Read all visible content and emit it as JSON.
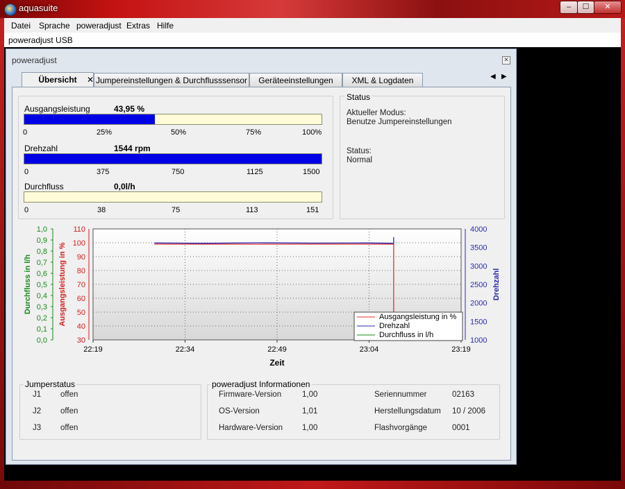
{
  "window": {
    "title": "aquasuite",
    "buttons": [
      "–",
      "☐",
      "✕"
    ]
  },
  "menu": [
    {
      "label": "Datei"
    },
    {
      "label": "Sprache"
    },
    {
      "label": "poweradjust"
    },
    {
      "label": "Extras"
    },
    {
      "label": "Hilfe"
    }
  ],
  "device_label": "poweradjust USB",
  "panel": {
    "title": "poweradjust",
    "tabs": [
      {
        "label": "Übersicht"
      },
      {
        "label": "Jumpereinstellungen & Durchflusssensor"
      },
      {
        "label": "Geräteeinstellungen"
      },
      {
        "label": "XML & Logdaten"
      }
    ],
    "tab_close": "✕",
    "tab_arrows": [
      "◀",
      "▶"
    ]
  },
  "gauges": [
    {
      "label": "Ausgangsleistung",
      "value_text": "43,95 %",
      "fraction": 0.4395,
      "ticks": [
        "0",
        "25%",
        "50%",
        "75%",
        "100%"
      ]
    },
    {
      "label": "Drehzahl",
      "value_text": "1544 rpm",
      "fraction": 1.0,
      "ticks": [
        "0",
        "375",
        "750",
        "1125",
        "1500"
      ]
    },
    {
      "label": "Durchfluss",
      "value_text": "0,0l/h",
      "fraction": 0.0,
      "ticks": [
        "0",
        "38",
        "75",
        "113",
        "151"
      ]
    }
  ],
  "status": {
    "title": "Status",
    "mode_label": "Aktueller Modus:",
    "mode_value": "Benutze Jumpereinstellungen",
    "status_label": "Status:",
    "status_value": "Normal"
  },
  "chart_data": {
    "type": "line",
    "xlabel": "Zeit",
    "x_ticks": [
      "22:19",
      "22:34",
      "22:49",
      "23:04",
      "23:19"
    ],
    "left_axis_flow": {
      "label": "Durchfluss in l/h",
      "ticks": [
        "1,0",
        "0,9",
        "0,8",
        "0,7",
        "0,6",
        "0,5",
        "0,4",
        "0,3",
        "0,2",
        "0,1",
        "0,0"
      ],
      "range": [
        0,
        1
      ],
      "color": "#1a8a1a"
    },
    "left_axis_power": {
      "label": "Ausgangsleistung in %",
      "ticks": [
        "110",
        "100",
        "90",
        "80",
        "70",
        "60",
        "50",
        "40",
        "30"
      ],
      "range": [
        30,
        110
      ],
      "color": "#d42020"
    },
    "right_axis_rpm": {
      "label": "Drehzahl",
      "ticks": [
        "4000",
        "3500",
        "3000",
        "2500",
        "2000",
        "1500",
        "1000"
      ],
      "range": [
        1000,
        4000
      ],
      "color": "#2a2ab0"
    },
    "series": [
      {
        "name": "Ausgangsleistung in %",
        "color": "#e03030",
        "axis": "power",
        "points": [
          [
            0.1667,
            99
          ],
          [
            0.8167,
            99
          ],
          [
            0.8167,
            44
          ]
        ]
      },
      {
        "name": "Drehzahl",
        "color": "#2a2ab0",
        "axis": "rpm",
        "points": [
          [
            0.1667,
            3620
          ],
          [
            0.3,
            3610
          ],
          [
            0.45,
            3625
          ],
          [
            0.6,
            3615
          ],
          [
            0.75,
            3620
          ],
          [
            0.8167,
            3610
          ],
          [
            0.8167,
            3780
          ]
        ]
      },
      {
        "name": "Durchfluss in l/h",
        "color": "#1a8a1a",
        "axis": "flow",
        "points": []
      }
    ],
    "grid": true,
    "legend": "bottom-right"
  },
  "jumper": {
    "title": "Jumperstatus",
    "rows": [
      {
        "name": "J1",
        "state": "offen"
      },
      {
        "name": "J2",
        "state": "offen"
      },
      {
        "name": "J3",
        "state": "offen"
      }
    ]
  },
  "info": {
    "title": "poweradjust Informationen",
    "left": [
      {
        "key": "Firmware-Version",
        "value": "1,00"
      },
      {
        "key": "OS-Version",
        "value": "1,01"
      },
      {
        "key": "Hardware-Version",
        "value": "1,00"
      }
    ],
    "right": [
      {
        "key": "Seriennummer",
        "value": "02163"
      },
      {
        "key": "Herstellungsdatum",
        "value": "10 / 2006"
      },
      {
        "key": "Flashvorgänge",
        "value": "0001"
      }
    ]
  }
}
